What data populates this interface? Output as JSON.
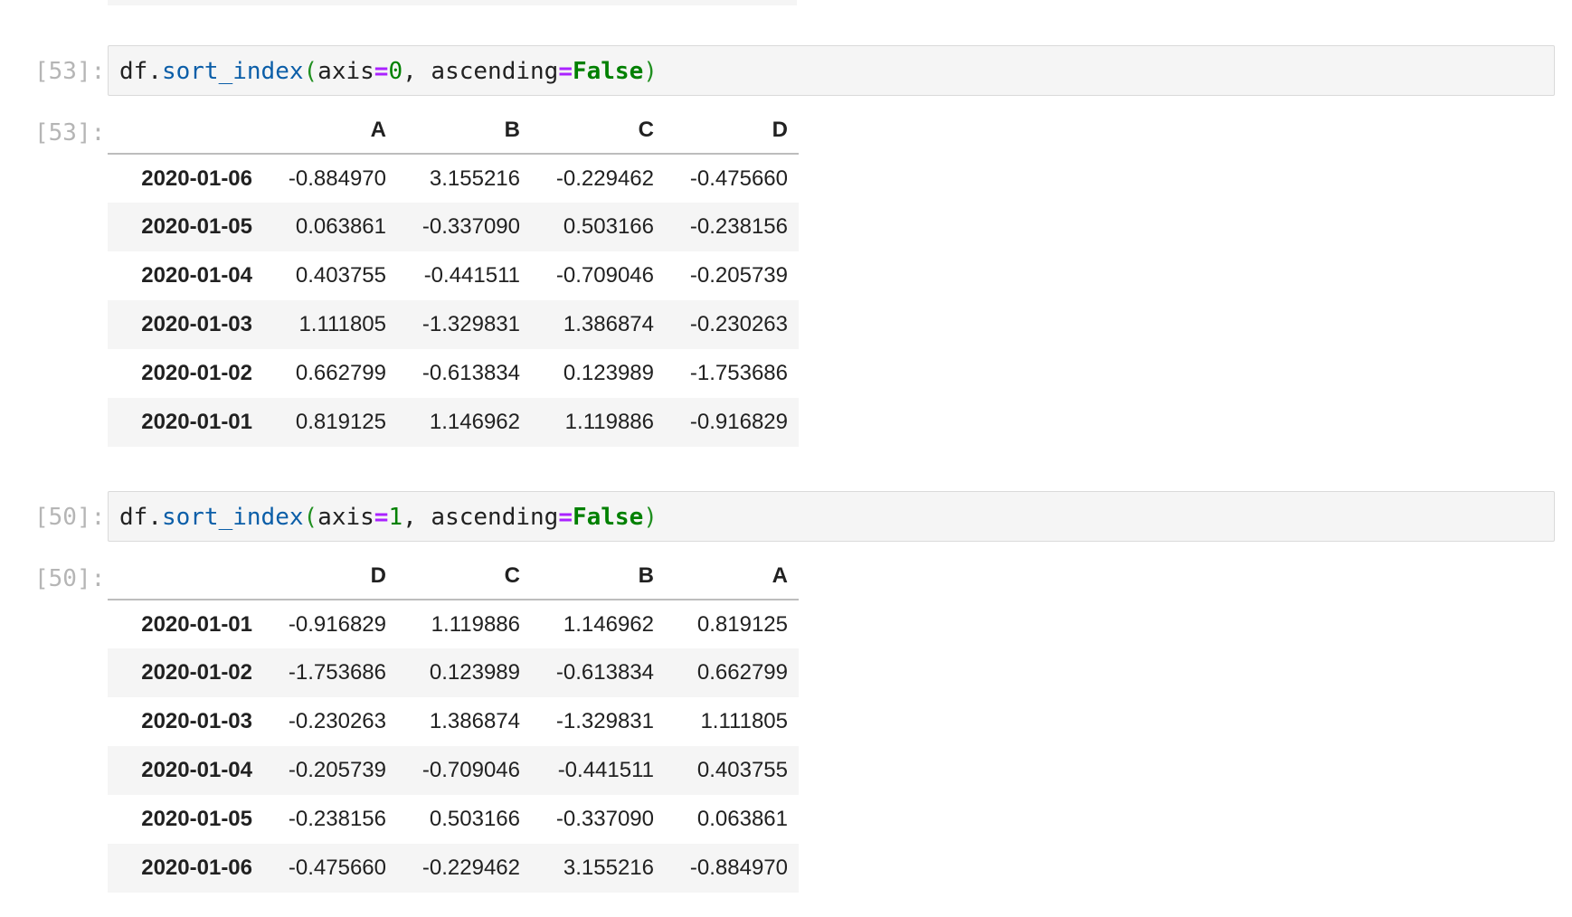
{
  "cells": [
    {
      "in_prompt": "[53]:",
      "out_prompt": "[53]:",
      "code": {
        "obj": "df",
        "dot": ".",
        "fn": "sort_index",
        "lparen": "(",
        "arg1_name": "axis",
        "eq1": "=",
        "arg1_val": "0",
        "sep": ", ",
        "arg2_name": "ascending",
        "eq2": "=",
        "arg2_val": "False",
        "rparen": ")"
      },
      "table": {
        "columns": [
          "A",
          "B",
          "C",
          "D"
        ],
        "rows": [
          {
            "index": "2020-01-06",
            "values": [
              "-0.884970",
              "3.155216",
              "-0.229462",
              "-0.475660"
            ]
          },
          {
            "index": "2020-01-05",
            "values": [
              "0.063861",
              "-0.337090",
              "0.503166",
              "-0.238156"
            ]
          },
          {
            "index": "2020-01-04",
            "values": [
              "0.403755",
              "-0.441511",
              "-0.709046",
              "-0.205739"
            ]
          },
          {
            "index": "2020-01-03",
            "values": [
              "1.111805",
              "-1.329831",
              "1.386874",
              "-0.230263"
            ]
          },
          {
            "index": "2020-01-02",
            "values": [
              "0.662799",
              "-0.613834",
              "0.123989",
              "-1.753686"
            ]
          },
          {
            "index": "2020-01-01",
            "values": [
              "0.819125",
              "1.146962",
              "1.119886",
              "-0.916829"
            ]
          }
        ]
      }
    },
    {
      "in_prompt": "[50]:",
      "out_prompt": "[50]:",
      "code": {
        "obj": "df",
        "dot": ".",
        "fn": "sort_index",
        "lparen": "(",
        "arg1_name": "axis",
        "eq1": "=",
        "arg1_val": "1",
        "sep": ", ",
        "arg2_name": "ascending",
        "eq2": "=",
        "arg2_val": "False",
        "rparen": ")"
      },
      "table": {
        "columns": [
          "D",
          "C",
          "B",
          "A"
        ],
        "rows": [
          {
            "index": "2020-01-01",
            "values": [
              "-0.916829",
              "1.119886",
              "1.146962",
              "0.819125"
            ]
          },
          {
            "index": "2020-01-02",
            "values": [
              "-1.753686",
              "0.123989",
              "-0.613834",
              "0.662799"
            ]
          },
          {
            "index": "2020-01-03",
            "values": [
              "-0.230263",
              "1.386874",
              "-1.329831",
              "1.111805"
            ]
          },
          {
            "index": "2020-01-04",
            "values": [
              "-0.205739",
              "-0.709046",
              "-0.441511",
              "0.403755"
            ]
          },
          {
            "index": "2020-01-05",
            "values": [
              "-0.238156",
              "0.503166",
              "-0.337090",
              "0.063861"
            ]
          },
          {
            "index": "2020-01-06",
            "values": [
              "-0.475660",
              "-0.229462",
              "3.155216",
              "-0.884970"
            ]
          }
        ]
      }
    }
  ]
}
